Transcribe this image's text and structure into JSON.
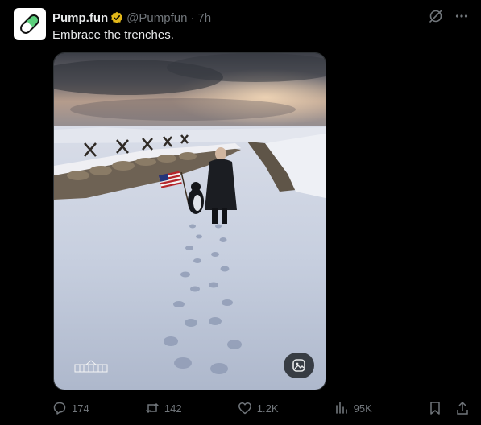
{
  "post": {
    "author_name": "Pump.fun",
    "handle": "@Pumpfun",
    "separator": "·",
    "time": "7h",
    "text": "Embrace the trenches."
  },
  "icons": {
    "avatar": "green-pill-icon",
    "verified": "verified-badge-icon",
    "grok": "grok-icon",
    "more": "more-icon",
    "reply": "reply-icon",
    "repost": "repost-icon",
    "like": "like-icon",
    "views": "views-icon",
    "bookmark": "bookmark-icon",
    "share": "share-icon",
    "alt": "image-alt-icon"
  },
  "stats": {
    "replies": "174",
    "reposts": "142",
    "likes": "1.2K",
    "views": "95K"
  },
  "colors": {
    "background": "#000000",
    "text": "#e7e9ea",
    "muted": "#71767b",
    "badge": "#e2b719",
    "pill_green": "#5ccf7c"
  }
}
